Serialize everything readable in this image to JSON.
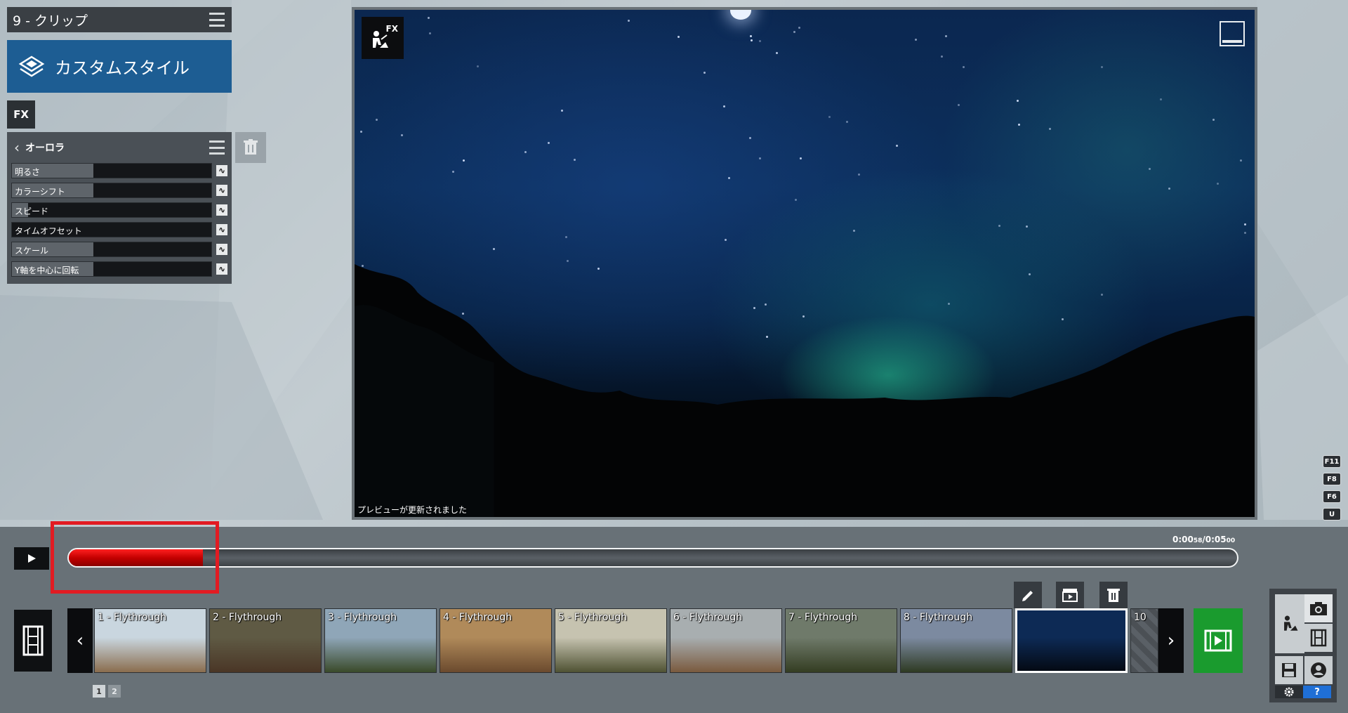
{
  "clip_header": {
    "title": "9 - クリップ"
  },
  "style_banner": {
    "label": "カスタムスタイル"
  },
  "fx_chip": {
    "label": "FX"
  },
  "fx_panel": {
    "name": "オーロラ",
    "params": [
      {
        "label": "明るさ",
        "value": 0.41
      },
      {
        "label": "カラーシフト",
        "value": 0.41
      },
      {
        "label": "スピード",
        "value": 0.08
      },
      {
        "label": "タイムオフセット",
        "value": 0.0
      },
      {
        "label": "スケール",
        "value": 0.41
      },
      {
        "label": "Y軸を中心に回転",
        "value": 0.41
      }
    ]
  },
  "preview": {
    "overlay_label": "FX",
    "status": "プレビューが更新されました"
  },
  "shortcut_keys": [
    "F11",
    "F8",
    "F6",
    "U"
  ],
  "timeline": {
    "time_current": "0:00",
    "time_current_frames": "58",
    "time_total": "0:05",
    "time_total_frames": "00",
    "progress": 0.115
  },
  "clips": [
    {
      "label": "1 - Flythrough",
      "sky": "#c9d6df",
      "ground": "#8a6d4e"
    },
    {
      "label": "2 - Flythrough",
      "sky": "#5f5a44",
      "ground": "#4a3626"
    },
    {
      "label": "3 - Flythrough",
      "sky": "#8fa6b8",
      "ground": "#3a4a2a"
    },
    {
      "label": "4 - Flythrough",
      "sky": "#b08a5a",
      "ground": "#6b4a2e"
    },
    {
      "label": "5 - Flythrough",
      "sky": "#c6c3b0",
      "ground": "#4f5233"
    },
    {
      "label": "6 - Flythrough",
      "sky": "#a8aeb0",
      "ground": "#7a5a3e"
    },
    {
      "label": "7 - Flythrough",
      "sky": "#6f7a6a",
      "ground": "#343d22"
    },
    {
      "label": "8 - Flythrough",
      "sky": "#7c8aa0",
      "ground": "#2e3a22"
    },
    {
      "label": "",
      "sky": "#0d2a55",
      "ground": "#040a14"
    }
  ],
  "clip_next_placeholder": "10",
  "pager": [
    "1",
    "2"
  ],
  "colors": {
    "accent_blue": "#1d5d93",
    "timeline_red": "#c40000",
    "render_green": "#1a9b2e",
    "highlight_red": "#e21b22"
  },
  "icons": {
    "menu": "hamburger-icon",
    "style": "layers-icon",
    "trash": "trash-icon",
    "play": "play-icon",
    "edit": "pencil-icon",
    "movie": "clapper-icon",
    "film": "film-strip-icon",
    "render": "render-video-icon",
    "camera": "camera-icon",
    "save": "save-icon",
    "settings": "gear-icon",
    "help": "?"
  }
}
